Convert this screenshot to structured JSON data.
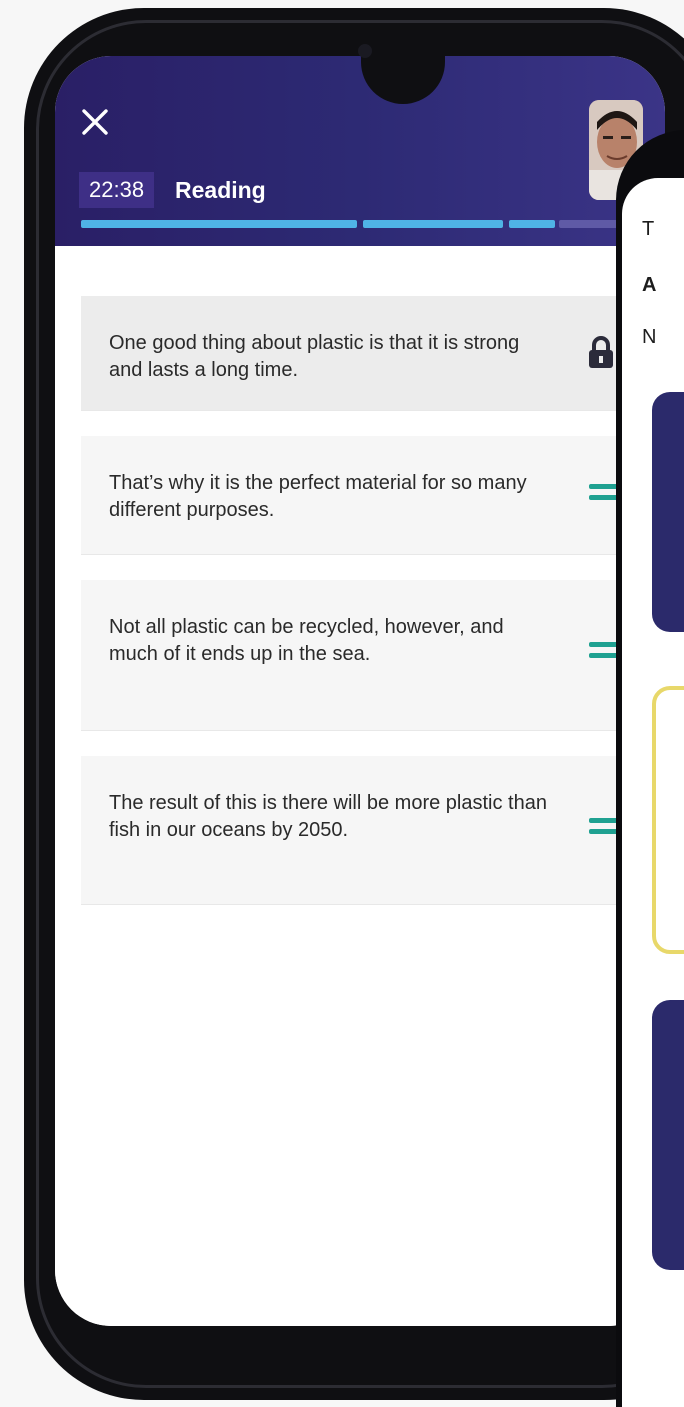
{
  "header": {
    "timer": "22:38",
    "section_title": "Reading",
    "progress_fraction": 0.75
  },
  "sentences": [
    {
      "text": "One good thing about plastic is that it is strong and lasts a long time.",
      "locked": true
    },
    {
      "text": "That’s why it is the perfect material for so many different purposes.",
      "locked": false
    },
    {
      "text": "Not all plastic can be recycled, however, and much of it ends up in the sea.",
      "locked": false
    },
    {
      "text": "The result of this is there will be more plastic than fish in our oceans by 2050.",
      "locked": false
    }
  ],
  "second_phone": {
    "fragments": [
      "T",
      "A",
      "N"
    ]
  },
  "colors": {
    "header_dark": "#2a1f66",
    "progress_active": "#4fb3e6",
    "handle_green": "#1fa191",
    "card_yellow_border": "#e8d86a",
    "card_navy": "#2b2a6b"
  }
}
